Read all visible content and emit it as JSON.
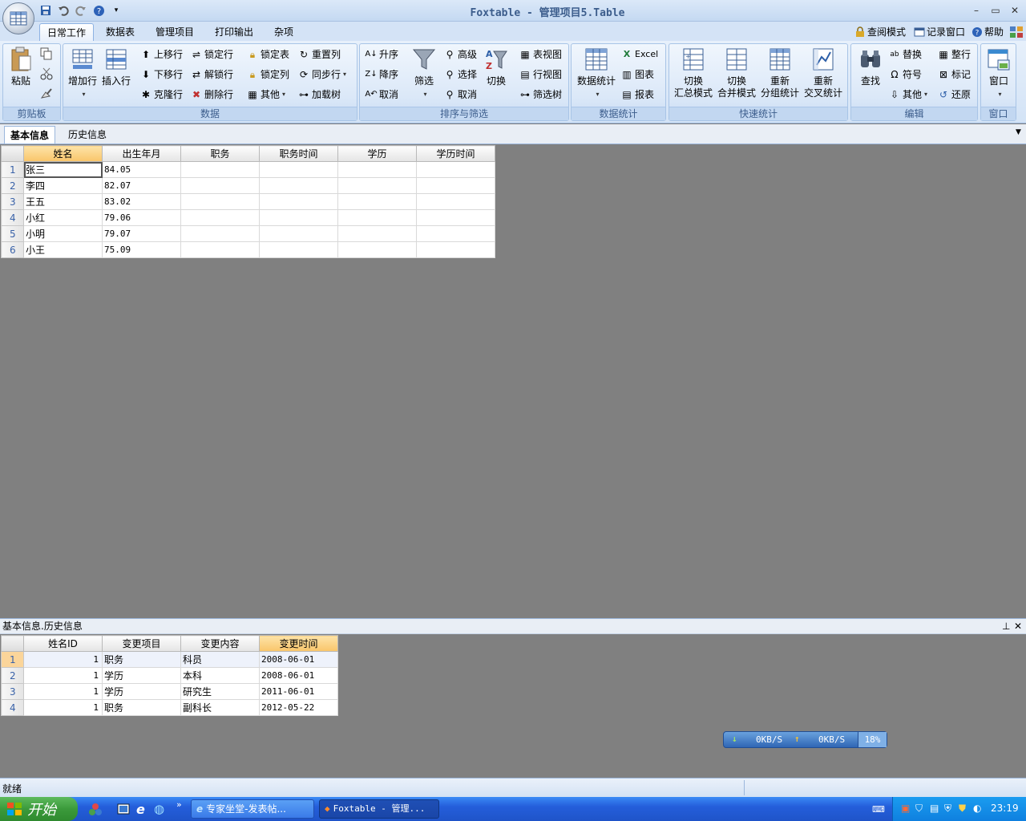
{
  "app": {
    "title": "Foxtable - 管理项目5.Table",
    "window_controls": {
      "minimize": "–",
      "restore": "▭",
      "close": "✕"
    }
  },
  "ribbon_tabs": [
    "日常工作",
    "数据表",
    "管理项目",
    "打印输出",
    "杂项"
  ],
  "ribbon_top_right": {
    "read_mode": "查阅模式",
    "log_window": "记录窗口",
    "help": "帮助"
  },
  "ribbon": {
    "clipboard": {
      "label": "剪贴板",
      "paste": "粘贴"
    },
    "data": {
      "label": "数据",
      "add_row": "增加行",
      "insert_row": "插入行",
      "move_up": "上移行",
      "move_down": "下移行",
      "clone_row": "克隆行",
      "lock_row": "锁定行",
      "unlock_row": "解锁行",
      "delete_row": "删除行",
      "lock_table": "锁定表",
      "lock_col": "锁定列",
      "other": "其他",
      "reset_col": "重置列",
      "sync_row": "同步行",
      "load_tree": "加载树"
    },
    "sort_filter": {
      "label": "排序与筛选",
      "asc": "升序",
      "desc": "降序",
      "cancel": "取消",
      "filter": "筛选",
      "advanced": "高级",
      "select": "选择",
      "cancel2": "取消",
      "toggle": "切换",
      "table_view": "表视图",
      "row_view": "行视图",
      "filter_tree": "筛选树"
    },
    "stats": {
      "label": "数据统计",
      "data_stats": "数据统计",
      "excel": "Excel",
      "chart": "图表",
      "report": "报表"
    },
    "quick_stats": {
      "label": "快速统计",
      "b1": [
        "切换",
        "汇总模式"
      ],
      "b2": [
        "切换",
        "合并模式"
      ],
      "b3": [
        "重新",
        "分组统计"
      ],
      "b4": [
        "重新",
        "交叉统计"
      ]
    },
    "edit": {
      "label": "编辑",
      "find": "查找",
      "replace": "替换",
      "symbol": "符号",
      "other": "其他",
      "whole_row": "整行",
      "mark": "标记",
      "restore": "还原"
    },
    "window": {
      "label": "窗口",
      "window": "窗口"
    }
  },
  "doc_tabs": [
    "基本信息",
    "历史信息"
  ],
  "main_table": {
    "columns": [
      "姓名",
      "出生年月",
      "职务",
      "职务时间",
      "学历",
      "学历时间"
    ],
    "rows": [
      [
        "1",
        "张三",
        "84.05",
        "",
        "",
        "",
        ""
      ],
      [
        "2",
        "李四",
        "82.07",
        "",
        "",
        "",
        ""
      ],
      [
        "3",
        "王五",
        "83.02",
        "",
        "",
        "",
        ""
      ],
      [
        "4",
        "小红",
        "79.06",
        "",
        "",
        "",
        ""
      ],
      [
        "5",
        "小明",
        "79.07",
        "",
        "",
        "",
        ""
      ],
      [
        "6",
        "小王",
        "75.09",
        "",
        "",
        "",
        ""
      ]
    ]
  },
  "sub_panel": {
    "title": "基本信息.历史信息",
    "pin": "ᵖ",
    "close": "✕",
    "columns": [
      "姓名ID",
      "变更项目",
      "变更内容",
      "变更时间"
    ],
    "rows": [
      [
        "1",
        "1",
        "职务",
        "科员",
        "2008-06-01"
      ],
      [
        "2",
        "1",
        "学历",
        "本科",
        "2008-06-01"
      ],
      [
        "3",
        "1",
        "学历",
        "研究生",
        "2011-06-01"
      ],
      [
        "4",
        "1",
        "职务",
        "副科长",
        "2012-05-22"
      ]
    ]
  },
  "net_widget": {
    "down": "0KB/S",
    "up": "0KB/S",
    "cpu": "18%"
  },
  "status": {
    "text": "就绪"
  },
  "taskbar": {
    "start": "开始",
    "tasks": [
      "专家坐堂-发表帖...",
      "Foxtable - 管理..."
    ],
    "clock": "23:19"
  }
}
